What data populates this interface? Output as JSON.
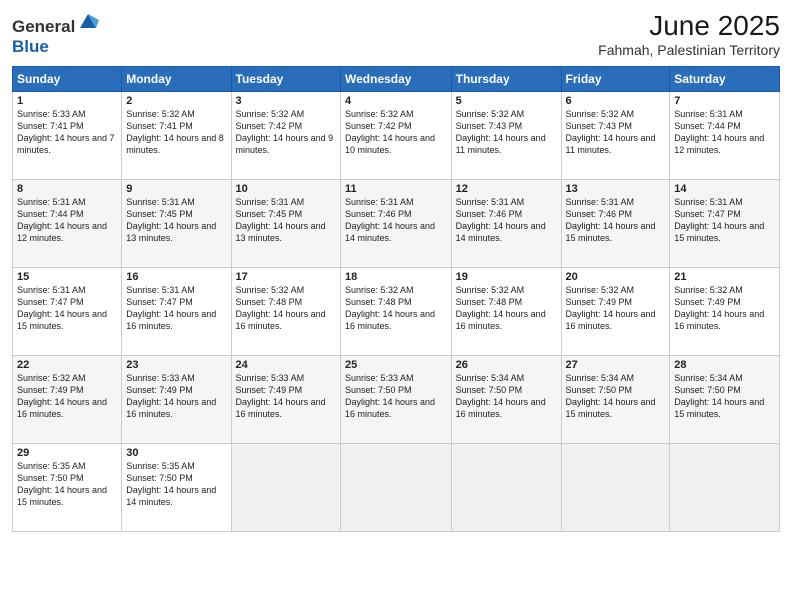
{
  "header": {
    "logo_general": "General",
    "logo_blue": "Blue",
    "month_year": "June 2025",
    "location": "Fahmah, Palestinian Territory"
  },
  "columns": [
    "Sunday",
    "Monday",
    "Tuesday",
    "Wednesday",
    "Thursday",
    "Friday",
    "Saturday"
  ],
  "weeks": [
    [
      {
        "day": "1",
        "sunrise": "5:33 AM",
        "sunset": "7:41 PM",
        "daylight": "14 hours and 7 minutes."
      },
      {
        "day": "2",
        "sunrise": "5:32 AM",
        "sunset": "7:41 PM",
        "daylight": "14 hours and 8 minutes."
      },
      {
        "day": "3",
        "sunrise": "5:32 AM",
        "sunset": "7:42 PM",
        "daylight": "14 hours and 9 minutes."
      },
      {
        "day": "4",
        "sunrise": "5:32 AM",
        "sunset": "7:42 PM",
        "daylight": "14 hours and 10 minutes."
      },
      {
        "day": "5",
        "sunrise": "5:32 AM",
        "sunset": "7:43 PM",
        "daylight": "14 hours and 11 minutes."
      },
      {
        "day": "6",
        "sunrise": "5:32 AM",
        "sunset": "7:43 PM",
        "daylight": "14 hours and 11 minutes."
      },
      {
        "day": "7",
        "sunrise": "5:31 AM",
        "sunset": "7:44 PM",
        "daylight": "14 hours and 12 minutes."
      }
    ],
    [
      {
        "day": "8",
        "sunrise": "5:31 AM",
        "sunset": "7:44 PM",
        "daylight": "14 hours and 12 minutes."
      },
      {
        "day": "9",
        "sunrise": "5:31 AM",
        "sunset": "7:45 PM",
        "daylight": "14 hours and 13 minutes."
      },
      {
        "day": "10",
        "sunrise": "5:31 AM",
        "sunset": "7:45 PM",
        "daylight": "14 hours and 13 minutes."
      },
      {
        "day": "11",
        "sunrise": "5:31 AM",
        "sunset": "7:46 PM",
        "daylight": "14 hours and 14 minutes."
      },
      {
        "day": "12",
        "sunrise": "5:31 AM",
        "sunset": "7:46 PM",
        "daylight": "14 hours and 14 minutes."
      },
      {
        "day": "13",
        "sunrise": "5:31 AM",
        "sunset": "7:46 PM",
        "daylight": "14 hours and 15 minutes."
      },
      {
        "day": "14",
        "sunrise": "5:31 AM",
        "sunset": "7:47 PM",
        "daylight": "14 hours and 15 minutes."
      }
    ],
    [
      {
        "day": "15",
        "sunrise": "5:31 AM",
        "sunset": "7:47 PM",
        "daylight": "14 hours and 15 minutes."
      },
      {
        "day": "16",
        "sunrise": "5:31 AM",
        "sunset": "7:47 PM",
        "daylight": "14 hours and 16 minutes."
      },
      {
        "day": "17",
        "sunrise": "5:32 AM",
        "sunset": "7:48 PM",
        "daylight": "14 hours and 16 minutes."
      },
      {
        "day": "18",
        "sunrise": "5:32 AM",
        "sunset": "7:48 PM",
        "daylight": "14 hours and 16 minutes."
      },
      {
        "day": "19",
        "sunrise": "5:32 AM",
        "sunset": "7:48 PM",
        "daylight": "14 hours and 16 minutes."
      },
      {
        "day": "20",
        "sunrise": "5:32 AM",
        "sunset": "7:49 PM",
        "daylight": "14 hours and 16 minutes."
      },
      {
        "day": "21",
        "sunrise": "5:32 AM",
        "sunset": "7:49 PM",
        "daylight": "14 hours and 16 minutes."
      }
    ],
    [
      {
        "day": "22",
        "sunrise": "5:32 AM",
        "sunset": "7:49 PM",
        "daylight": "14 hours and 16 minutes."
      },
      {
        "day": "23",
        "sunrise": "5:33 AM",
        "sunset": "7:49 PM",
        "daylight": "14 hours and 16 minutes."
      },
      {
        "day": "24",
        "sunrise": "5:33 AM",
        "sunset": "7:49 PM",
        "daylight": "14 hours and 16 minutes."
      },
      {
        "day": "25",
        "sunrise": "5:33 AM",
        "sunset": "7:50 PM",
        "daylight": "14 hours and 16 minutes."
      },
      {
        "day": "26",
        "sunrise": "5:34 AM",
        "sunset": "7:50 PM",
        "daylight": "14 hours and 16 minutes."
      },
      {
        "day": "27",
        "sunrise": "5:34 AM",
        "sunset": "7:50 PM",
        "daylight": "14 hours and 15 minutes."
      },
      {
        "day": "28",
        "sunrise": "5:34 AM",
        "sunset": "7:50 PM",
        "daylight": "14 hours and 15 minutes."
      }
    ],
    [
      {
        "day": "29",
        "sunrise": "5:35 AM",
        "sunset": "7:50 PM",
        "daylight": "14 hours and 15 minutes."
      },
      {
        "day": "30",
        "sunrise": "5:35 AM",
        "sunset": "7:50 PM",
        "daylight": "14 hours and 14 minutes."
      },
      null,
      null,
      null,
      null,
      null
    ]
  ]
}
